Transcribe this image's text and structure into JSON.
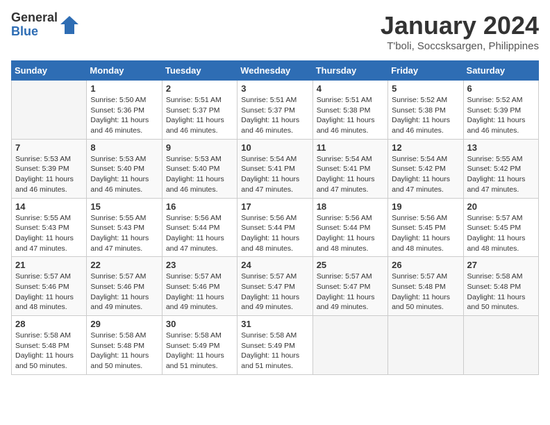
{
  "logo": {
    "general": "General",
    "blue": "Blue"
  },
  "title": "January 2024",
  "location": "T'boli, Soccsksargen, Philippines",
  "days_header": [
    "Sunday",
    "Monday",
    "Tuesday",
    "Wednesday",
    "Thursday",
    "Friday",
    "Saturday"
  ],
  "weeks": [
    [
      {
        "num": "",
        "info": ""
      },
      {
        "num": "1",
        "info": "Sunrise: 5:50 AM\nSunset: 5:36 PM\nDaylight: 11 hours\nand 46 minutes."
      },
      {
        "num": "2",
        "info": "Sunrise: 5:51 AM\nSunset: 5:37 PM\nDaylight: 11 hours\nand 46 minutes."
      },
      {
        "num": "3",
        "info": "Sunrise: 5:51 AM\nSunset: 5:37 PM\nDaylight: 11 hours\nand 46 minutes."
      },
      {
        "num": "4",
        "info": "Sunrise: 5:51 AM\nSunset: 5:38 PM\nDaylight: 11 hours\nand 46 minutes."
      },
      {
        "num": "5",
        "info": "Sunrise: 5:52 AM\nSunset: 5:38 PM\nDaylight: 11 hours\nand 46 minutes."
      },
      {
        "num": "6",
        "info": "Sunrise: 5:52 AM\nSunset: 5:39 PM\nDaylight: 11 hours\nand 46 minutes."
      }
    ],
    [
      {
        "num": "7",
        "info": "Sunrise: 5:53 AM\nSunset: 5:39 PM\nDaylight: 11 hours\nand 46 minutes."
      },
      {
        "num": "8",
        "info": "Sunrise: 5:53 AM\nSunset: 5:40 PM\nDaylight: 11 hours\nand 46 minutes."
      },
      {
        "num": "9",
        "info": "Sunrise: 5:53 AM\nSunset: 5:40 PM\nDaylight: 11 hours\nand 46 minutes."
      },
      {
        "num": "10",
        "info": "Sunrise: 5:54 AM\nSunset: 5:41 PM\nDaylight: 11 hours\nand 47 minutes."
      },
      {
        "num": "11",
        "info": "Sunrise: 5:54 AM\nSunset: 5:41 PM\nDaylight: 11 hours\nand 47 minutes."
      },
      {
        "num": "12",
        "info": "Sunrise: 5:54 AM\nSunset: 5:42 PM\nDaylight: 11 hours\nand 47 minutes."
      },
      {
        "num": "13",
        "info": "Sunrise: 5:55 AM\nSunset: 5:42 PM\nDaylight: 11 hours\nand 47 minutes."
      }
    ],
    [
      {
        "num": "14",
        "info": "Sunrise: 5:55 AM\nSunset: 5:43 PM\nDaylight: 11 hours\nand 47 minutes."
      },
      {
        "num": "15",
        "info": "Sunrise: 5:55 AM\nSunset: 5:43 PM\nDaylight: 11 hours\nand 47 minutes."
      },
      {
        "num": "16",
        "info": "Sunrise: 5:56 AM\nSunset: 5:44 PM\nDaylight: 11 hours\nand 47 minutes."
      },
      {
        "num": "17",
        "info": "Sunrise: 5:56 AM\nSunset: 5:44 PM\nDaylight: 11 hours\nand 48 minutes."
      },
      {
        "num": "18",
        "info": "Sunrise: 5:56 AM\nSunset: 5:44 PM\nDaylight: 11 hours\nand 48 minutes."
      },
      {
        "num": "19",
        "info": "Sunrise: 5:56 AM\nSunset: 5:45 PM\nDaylight: 11 hours\nand 48 minutes."
      },
      {
        "num": "20",
        "info": "Sunrise: 5:57 AM\nSunset: 5:45 PM\nDaylight: 11 hours\nand 48 minutes."
      }
    ],
    [
      {
        "num": "21",
        "info": "Sunrise: 5:57 AM\nSunset: 5:46 PM\nDaylight: 11 hours\nand 48 minutes."
      },
      {
        "num": "22",
        "info": "Sunrise: 5:57 AM\nSunset: 5:46 PM\nDaylight: 11 hours\nand 49 minutes."
      },
      {
        "num": "23",
        "info": "Sunrise: 5:57 AM\nSunset: 5:46 PM\nDaylight: 11 hours\nand 49 minutes."
      },
      {
        "num": "24",
        "info": "Sunrise: 5:57 AM\nSunset: 5:47 PM\nDaylight: 11 hours\nand 49 minutes."
      },
      {
        "num": "25",
        "info": "Sunrise: 5:57 AM\nSunset: 5:47 PM\nDaylight: 11 hours\nand 49 minutes."
      },
      {
        "num": "26",
        "info": "Sunrise: 5:57 AM\nSunset: 5:48 PM\nDaylight: 11 hours\nand 50 minutes."
      },
      {
        "num": "27",
        "info": "Sunrise: 5:58 AM\nSunset: 5:48 PM\nDaylight: 11 hours\nand 50 minutes."
      }
    ],
    [
      {
        "num": "28",
        "info": "Sunrise: 5:58 AM\nSunset: 5:48 PM\nDaylight: 11 hours\nand 50 minutes."
      },
      {
        "num": "29",
        "info": "Sunrise: 5:58 AM\nSunset: 5:48 PM\nDaylight: 11 hours\nand 50 minutes."
      },
      {
        "num": "30",
        "info": "Sunrise: 5:58 AM\nSunset: 5:49 PM\nDaylight: 11 hours\nand 51 minutes."
      },
      {
        "num": "31",
        "info": "Sunrise: 5:58 AM\nSunset: 5:49 PM\nDaylight: 11 hours\nand 51 minutes."
      },
      {
        "num": "",
        "info": ""
      },
      {
        "num": "",
        "info": ""
      },
      {
        "num": "",
        "info": ""
      }
    ]
  ]
}
